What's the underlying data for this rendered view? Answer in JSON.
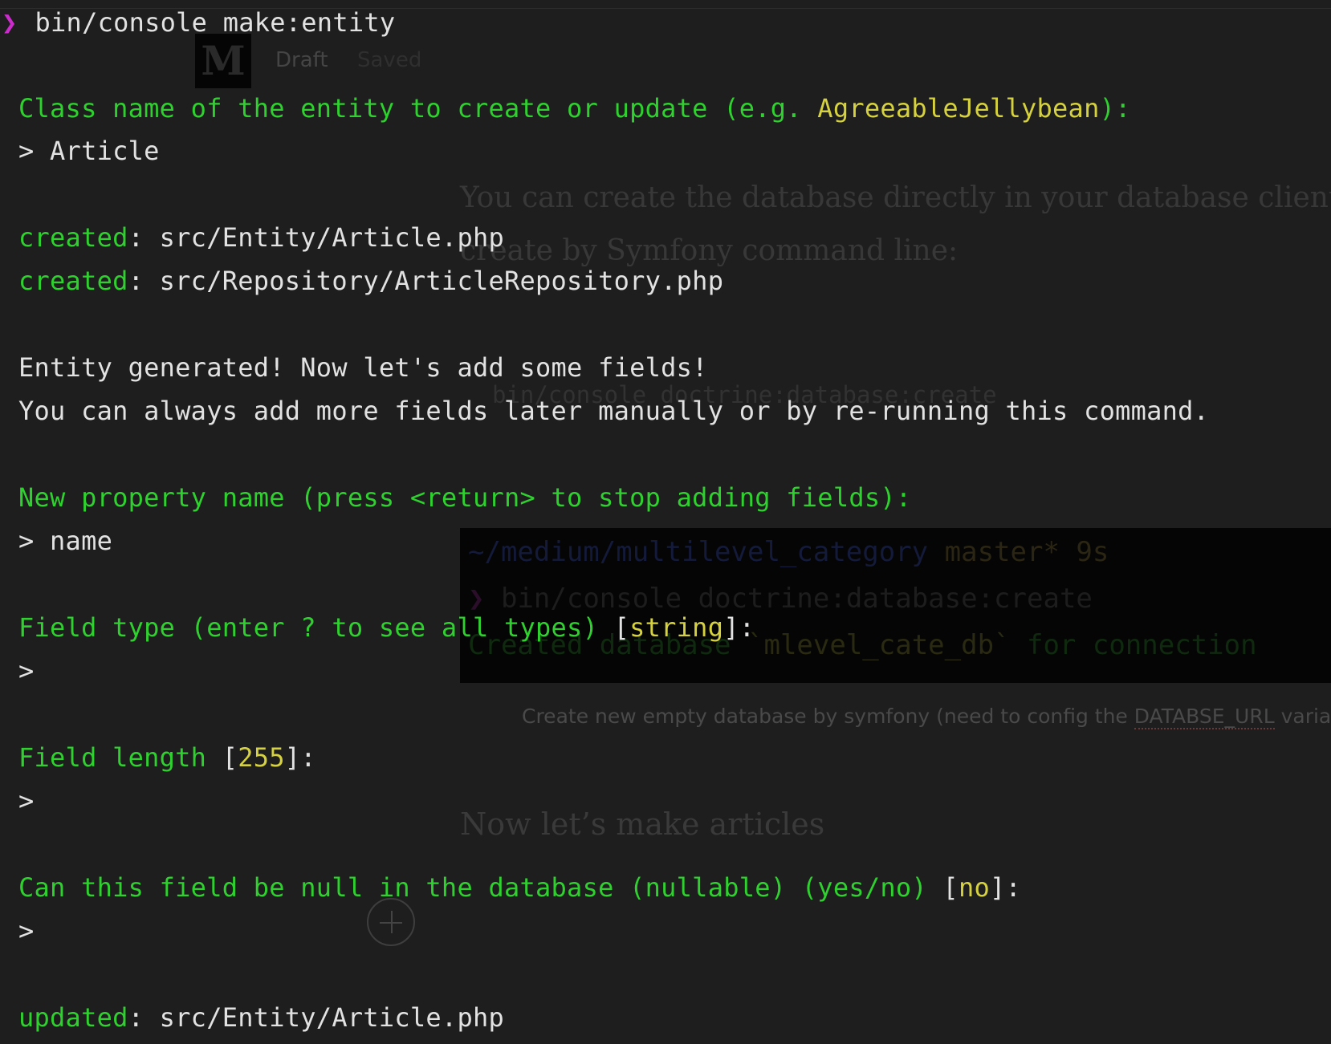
{
  "terminal": {
    "prompt_symbol": "❯",
    "command": "bin/console make:entity",
    "class_prompt": {
      "text": "Class name of the entity to create or update (e.g. ",
      "example": "AgreeableJellybean",
      "suffix": "):"
    },
    "class_answer": "> Article",
    "created_label": "created",
    "created_files": [
      "src/Entity/Article.php",
      "src/Repository/ArticleRepository.php"
    ],
    "info_lines": [
      "Entity generated! Now let's add some fields!",
      "You can always add more fields later manually or by re-running this command."
    ],
    "property_prompt": "New property name (press <return> to stop adding fields):",
    "property_answer": "> name",
    "field_type_prompt": {
      "text": "Field type (enter ? to see all types) ",
      "default": "string"
    },
    "field_length_prompt": {
      "text": "Field length ",
      "default": "255"
    },
    "nullable_prompt": {
      "text": "Can this field be null in the database (nullable) (yes/no) ",
      "default": "no"
    },
    "empty_answer": ">",
    "updated_label": "updated",
    "updated_file": "src/Entity/Article.php",
    "colors": {
      "background": "#1e1e1e",
      "green": "#2fd12f",
      "yellow": "#d6d23f",
      "white": "#e2e2e2",
      "magenta": "#cc2ccc"
    }
  },
  "background_editor": {
    "logo_letter": "M",
    "status_draft": "Draft",
    "status_saved": "Saved",
    "paragraph_lines": [
      "You can create the database directly in your database client i",
      "create by Symfony command line:"
    ],
    "code_snippet": "bin/console doctrine:database:create",
    "image_lines": {
      "path": "~/medium/multilevel_category",
      "branch": "master* 9s",
      "prompt": "❯",
      "command": "bin/console doctrine:database:create",
      "result_prefix": "Created database ",
      "result_db": "`mlevel_cate_db`",
      "result_suffix": " for connection"
    },
    "caption": {
      "before": "Create new empty database by symfony (need to config the ",
      "underlined": "DATABSE_URL",
      "after": " varia"
    },
    "heading": "Now let’s make articles"
  }
}
